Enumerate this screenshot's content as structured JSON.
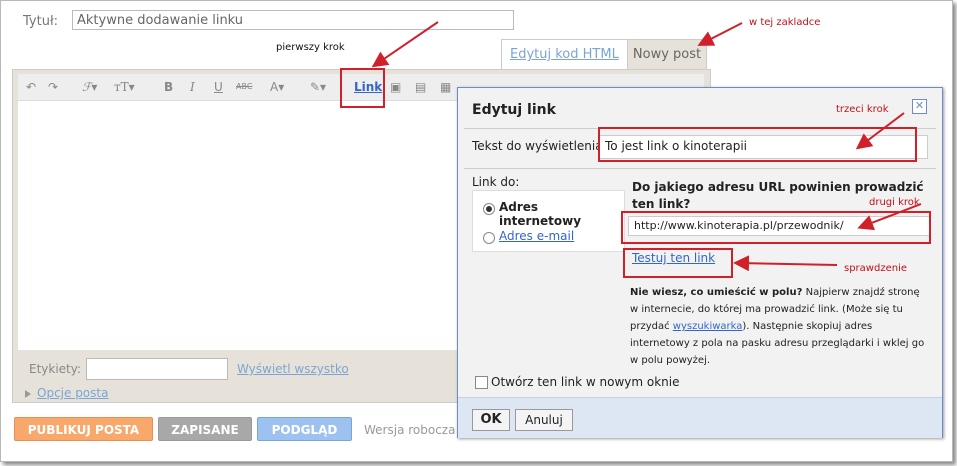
{
  "post": {
    "title_label": "Tytuł:",
    "title_value": "Aktywne dodawanie linku"
  },
  "tabs": [
    {
      "label": "Edytuj kod HTML"
    },
    {
      "label": "Nowy post"
    }
  ],
  "toolbar": {
    "link_label": "Link"
  },
  "labels": {
    "label": "Etykiety:",
    "show_all": "Wyświetl wszystko",
    "post_options": "Opcje posta"
  },
  "buttons": {
    "publish": "PUBLIKUJ POSTA",
    "saved": "ZAPISANE",
    "preview": "PODGLĄD",
    "draft_text": "Wersja robocza"
  },
  "dialog": {
    "title": "Edytuj link",
    "display_text_label": "Tekst do wyświetlenia:",
    "display_text_value": "To jest link o kinoterapii",
    "link_to_label": "Link do:",
    "option_web": "Adres internetowy",
    "option_email": "Adres e-mail",
    "url_question": "Do jakiego adresu URL powinien prowadzić ten link?",
    "url_value": "http://www.kinoterapia.pl/przewodnik/",
    "test_link": "Testuj ten link",
    "help_bold": "Nie wiesz, co umieścić w polu?",
    "help_1": " Najpierw znajdź stronę w internecie, do której ma prowadzić link. (Może się tu przydać ",
    "help_link": "wyszukiwarka",
    "help_2": "). Następnie skopiuj adres internetowy z pola na pasku adresu przeglądarki i wklej go w polu powyżej.",
    "new_window": "Otwórz ten link w nowym oknie",
    "ok": "OK",
    "cancel": "Anuluj"
  },
  "annotations": {
    "step1": "pierwszy krok",
    "step2": "drugi krok",
    "step3": "trzeci krok",
    "tab_hint": "w tej zakladce",
    "check": "sprawdzenie"
  },
  "colors": {
    "annotation_red": "#d0202a",
    "link_blue": "#3366cc",
    "publish_orange": "#f7a86a",
    "preview_blue": "#9ec2f0"
  }
}
